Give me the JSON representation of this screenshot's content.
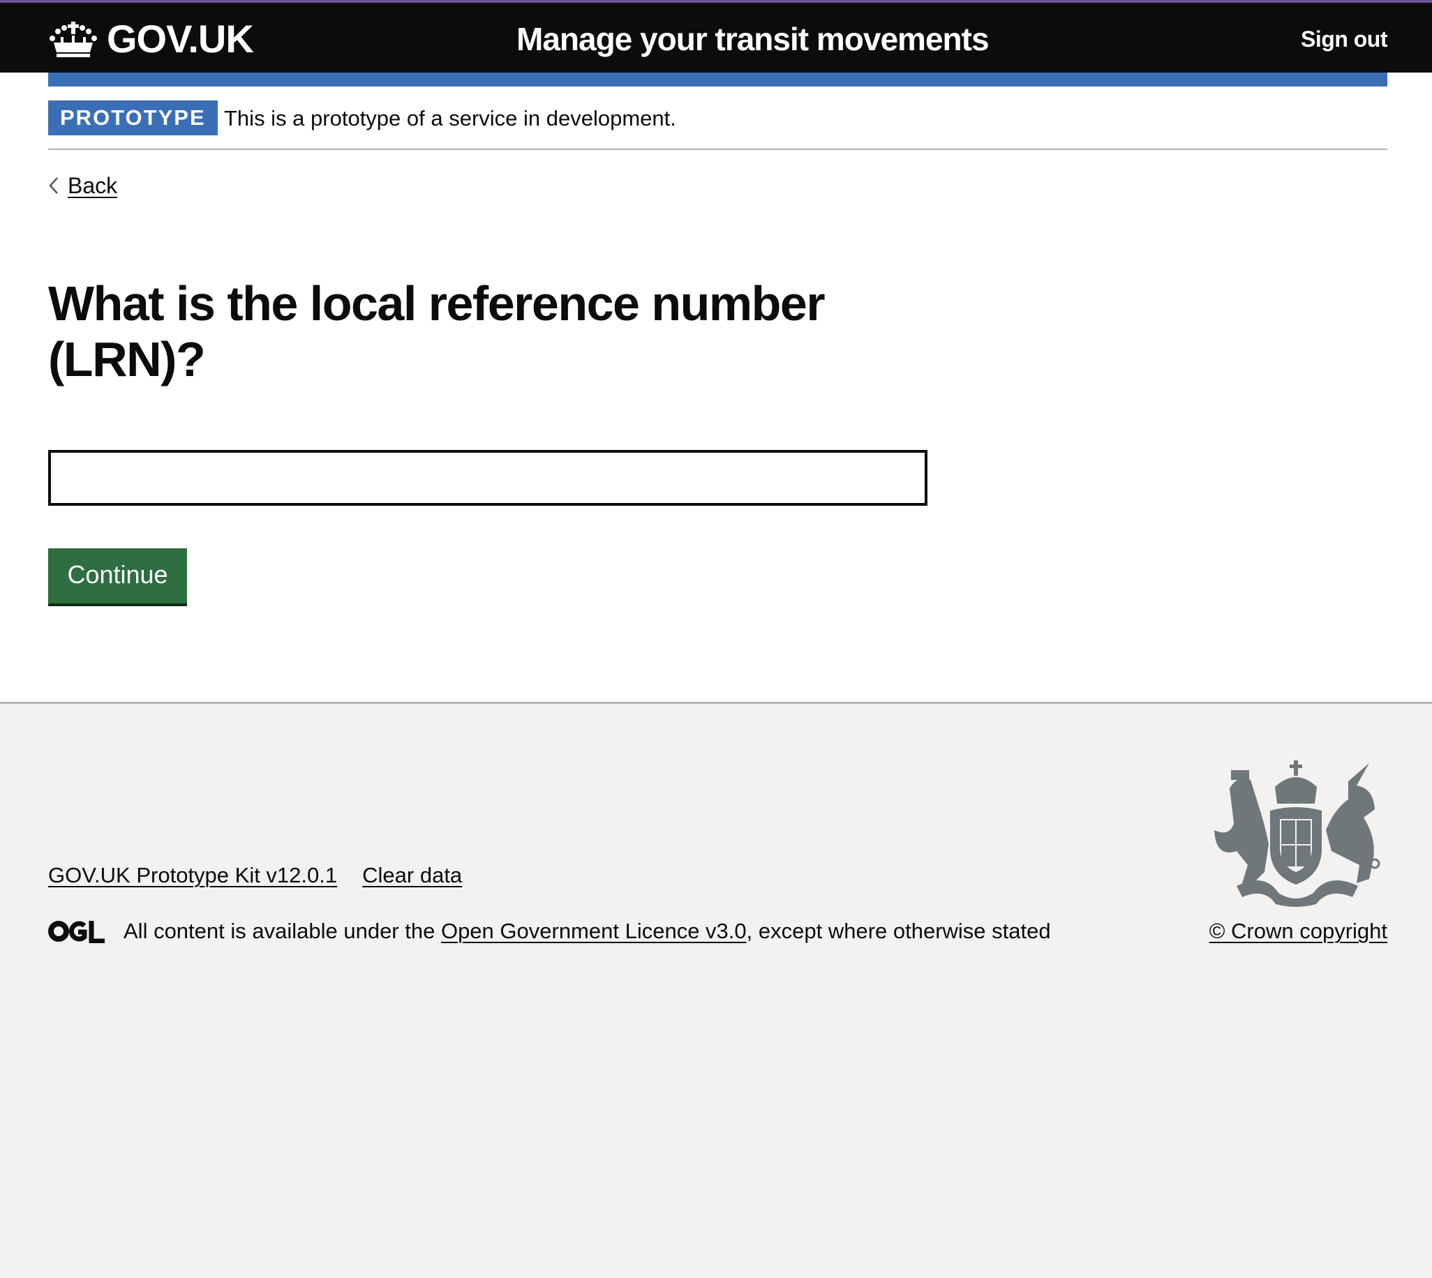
{
  "header": {
    "logo_text": "GOV.UK",
    "logo_icon": "crown-icon",
    "service_name": "Manage your transit movements",
    "sign_out_label": "Sign out"
  },
  "colors": {
    "header_bg": "#0b0c0c",
    "header_top_line": "#6f4f9b",
    "accent_blue": "#3a6fb5",
    "button_green": "#2e6e41",
    "footer_bg": "#f3f2f1"
  },
  "phase_banner": {
    "tag": "PROTOTYPE",
    "text": "This is a prototype of a service in development."
  },
  "back_link": {
    "icon": "chevron-left-icon",
    "label": "Back"
  },
  "main": {
    "heading": "What is the local reference number (LRN)?",
    "lrn_input": {
      "value": "",
      "placeholder": ""
    },
    "continue_label": "Continue"
  },
  "footer": {
    "links": [
      {
        "label": "GOV.UK Prototype Kit v12.0.1"
      },
      {
        "label": "Clear data"
      }
    ],
    "licence_logo": "ogl-logo",
    "licence_prefix": "All content is available under the ",
    "licence_link": "Open Government Licence v3.0",
    "licence_suffix": ", except where otherwise stated",
    "crest_icon": "royal-coat-of-arms-icon",
    "copyright_label": "© Crown copyright"
  }
}
